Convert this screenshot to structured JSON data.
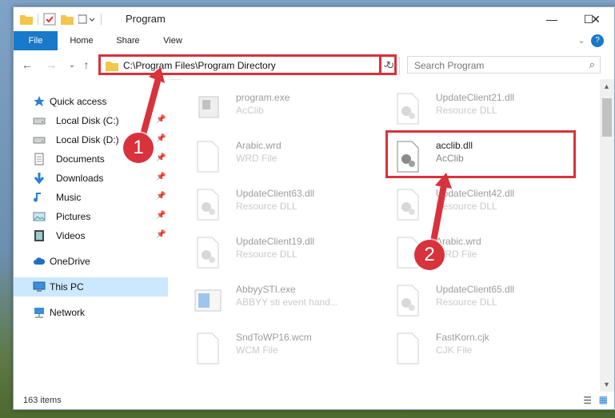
{
  "window": {
    "title": "Program",
    "controls": {
      "minimize": "—",
      "maximize": "☐",
      "close": "✕"
    }
  },
  "ribbon": {
    "tabs": [
      "File",
      "Home",
      "Share",
      "View"
    ],
    "help": "?"
  },
  "address": {
    "path": "C:\\Program Files\\Program Directory",
    "search_placeholder": "Search Program"
  },
  "sidebar": {
    "items": [
      {
        "label": "Quick access",
        "icon": "star-icon",
        "pinned": false
      },
      {
        "label": "Local Disk (C:)",
        "icon": "drive-icon",
        "pinned": true
      },
      {
        "label": "Local Disk (D:)",
        "icon": "drive-icon",
        "pinned": true
      },
      {
        "label": "Documents",
        "icon": "documents-icon",
        "pinned": true
      },
      {
        "label": "Downloads",
        "icon": "download-icon",
        "pinned": true
      },
      {
        "label": "Music",
        "icon": "music-icon",
        "pinned": true
      },
      {
        "label": "Pictures",
        "icon": "pictures-icon",
        "pinned": true
      },
      {
        "label": "Videos",
        "icon": "videos-icon",
        "pinned": true
      },
      {
        "label": "OneDrive",
        "icon": "cloud-icon",
        "pinned": false
      },
      {
        "label": "This PC",
        "icon": "computer-icon",
        "pinned": false,
        "selected": true
      },
      {
        "label": "Network",
        "icon": "network-icon",
        "pinned": false
      }
    ]
  },
  "files": [
    {
      "name": "program.exe",
      "type": "AcClib",
      "icon": "exe-icon",
      "highlight": false
    },
    {
      "name": "UpdateClient21.dll",
      "type": "Resource DLL",
      "icon": "dll-icon",
      "highlight": false
    },
    {
      "name": "Arabic.wrd",
      "type": "WRD File",
      "icon": "blank-file-icon",
      "highlight": false
    },
    {
      "name": "acclib.dll",
      "type": "AcClib",
      "icon": "dll-icon",
      "highlight": true
    },
    {
      "name": "UpdateClient63.dll",
      "type": "Resource DLL",
      "icon": "dll-icon",
      "highlight": false
    },
    {
      "name": "UpdateClient42.dll",
      "type": "Resource DLL",
      "icon": "dll-icon",
      "highlight": false
    },
    {
      "name": "UpdateClient19.dll",
      "type": "Resource DLL",
      "icon": "dll-icon",
      "highlight": false
    },
    {
      "name": "Arabic.wrd",
      "type": "WRD File",
      "icon": "blank-file-icon",
      "highlight": false
    },
    {
      "name": "AbbyySTI.exe",
      "type": "ABBYY sti event hand...",
      "icon": "exe-blue-icon",
      "highlight": false
    },
    {
      "name": "UpdateClient65.dll",
      "type": "Resource DLL",
      "icon": "dll-icon",
      "highlight": false
    },
    {
      "name": "SndToWP16.wcm",
      "type": "WCM File",
      "icon": "blank-file-icon",
      "highlight": false
    },
    {
      "name": "FastKorn.cjk",
      "type": "CJK File",
      "icon": "blank-file-icon",
      "highlight": false
    }
  ],
  "status": {
    "count": "163 items"
  },
  "annotations": {
    "step1": "1",
    "step2": "2"
  },
  "colors": {
    "accent": "#1979ca",
    "highlight": "#d8323c",
    "selected": "#cce8ff"
  }
}
